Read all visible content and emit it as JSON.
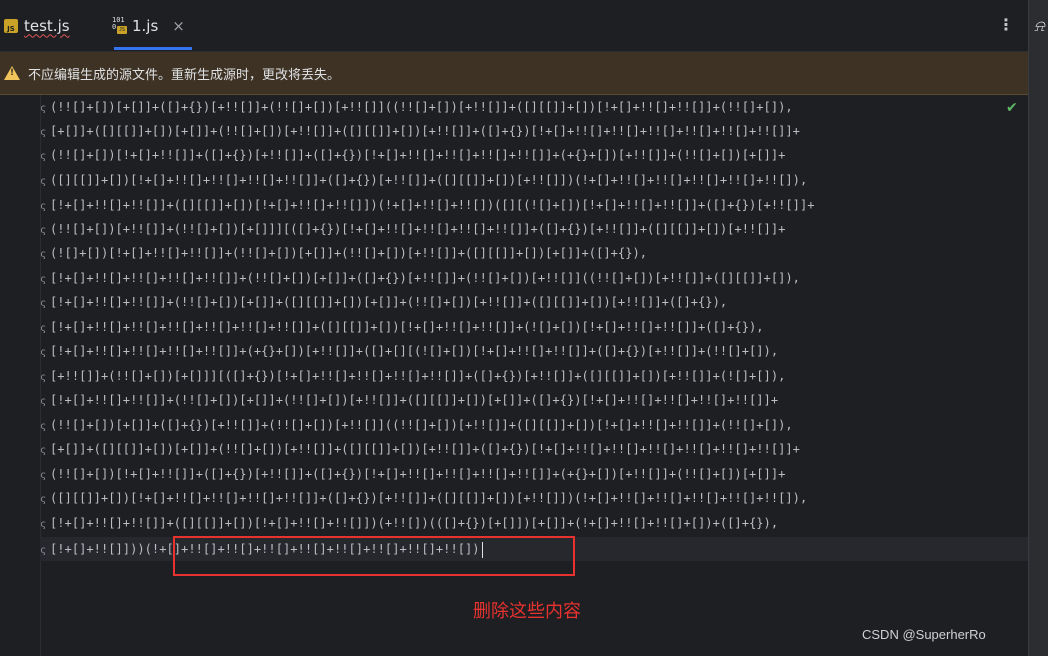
{
  "tabs": [
    {
      "label": "test.js",
      "icon": "js-file-icon"
    },
    {
      "label": "1.js",
      "icon": "binary-js-file-icon",
      "active": true
    }
  ],
  "tab_close": "×",
  "more_menu": "⋮",
  "banner": {
    "text": "不应编辑生成的源文件。重新生成源时，更改将丢失。"
  },
  "code_lines": [
    "(!![]+[])[+[]]+([]+{})[+!![]]+(!![]+[])[+!![]]((!![]+[])[+!![]]+([][[]]+[])[!+[]+!![]+!![]]+(!![]+[]),",
    "[+[]]+([][[]]+[])[+[]]+(!![]+[])[+!![]]+([][[]]+[])[+!![]]+([]+{})[!+[]+!![]+!![]+!![]+!![]+!![]+!![]]+",
    "(!![]+[])[!+[]+!![]]+([]+{})[+!![]]+([]+{})[!+[]+!![]+!![]+!![]+!![]]+(+{}+[])[+!![]]+(!![]+[])[+[]]+",
    "([][[]]+[])[!+[]+!![]+!![]+!![]+!![]]+([]+{})[+!![]]+([][[]]+[])[+!![]])(!+[]+!![]+!![]+!![]+!![]+!![]),",
    "[!+[]+!![]+!![]]+([][[]]+[])[!+[]+!![]+!![]])(!+[]+!![]+!![])([][(![]+[])[!+[]+!![]+!![]]+([]+{})[+!![]]+",
    "(!![]+[])[+!![]]+(!![]+[])[+[]]][([]+{})[!+[]+!![]+!![]+!![]+!![]]+([]+{})[+!![]]+([][[]]+[])[+!![]]+",
    "(![]+[])[!+[]+!![]+!![]]+(!![]+[])[+[]]+(!![]+[])[+!![]]+([][[]]+[])[+[]]+([]+{}),",
    "[!+[]+!![]+!![]+!![]+!![]]+(!![]+[])[+[]]+([]+{})[+!![]]+(!![]+[])[+!![]]((!![]+[])[+!![]]+([][[]]+[]),",
    "[!+[]+!![]+!![]]+(!![]+[])[+[]]+([][[]]+[])[+[]]+(!![]+[])[+!![]]+([][[]]+[])[+!![]]+([]+{}),",
    "[!+[]+!![]+!![]+!![]+!![]+!![]+!![]]+([][[]]+[])[!+[]+!![]+!![]]+(![]+[])[!+[]+!![]+!![]]+([]+{}),",
    "[!+[]+!![]+!![]+!![]+!![]]+(+{}+[])[+!![]]+([]+[][(![]+[])[!+[]+!![]+!![]]+([]+{})[+!![]]+(!![]+[]),",
    "[+!![]]+(!![]+[])[+[]]][([]+{})[!+[]+!![]+!![]+!![]+!![]]+([]+{})[+!![]]+([][[]]+[])[+!![]]+(![]+[]),",
    "[!+[]+!![]+!![]]+(!![]+[])[+[]]+(!![]+[])[+!![]]+([][[]]+[])[+[]]+([]+{})[!+[]+!![]+!![]+!![]+!![]]+",
    "(!![]+[])[+[]]+([]+{})[+!![]]+(!![]+[])[+!![]]((!![]+[])[+!![]]+([][[]]+[])[!+[]+!![]+!![]]+(!![]+[]),",
    "[+[]]+([][[]]+[])[+[]]+(!![]+[])[+!![]]+([][[]]+[])[+!![]]+([]+{})[!+[]+!![]+!![]+!![]+!![]+!![]+!![]]+",
    "(!![]+[])[!+[]+!![]]+([]+{})[+!![]]+([]+{})[!+[]+!![]+!![]+!![]+!![]]+(+{}+[])[+!![]]+(!![]+[])[+[]]+",
    "([][[]]+[])[!+[]+!![]+!![]+!![]+!![]]+([]+{})[+!![]]+([][[]]+[])[+!![]])(!+[]+!![]+!![]+!![]+!![]+!![]),",
    "[!+[]+!![]+!![]]+([][[]]+[])[!+[]+!![]+!![]])(+!![])(([]+{})[+[]])[+[]]+(!+[]+!![]+!![]+[])+([]+{}),",
    "[!+[]+!![]]))(!+[]+!![]+!![]+!![]+!![]+!![]+!![]+!![]+!![])"
  ],
  "annotation": {
    "text": "删除这些内容"
  },
  "watermark": "CSDN @SuperherRo"
}
